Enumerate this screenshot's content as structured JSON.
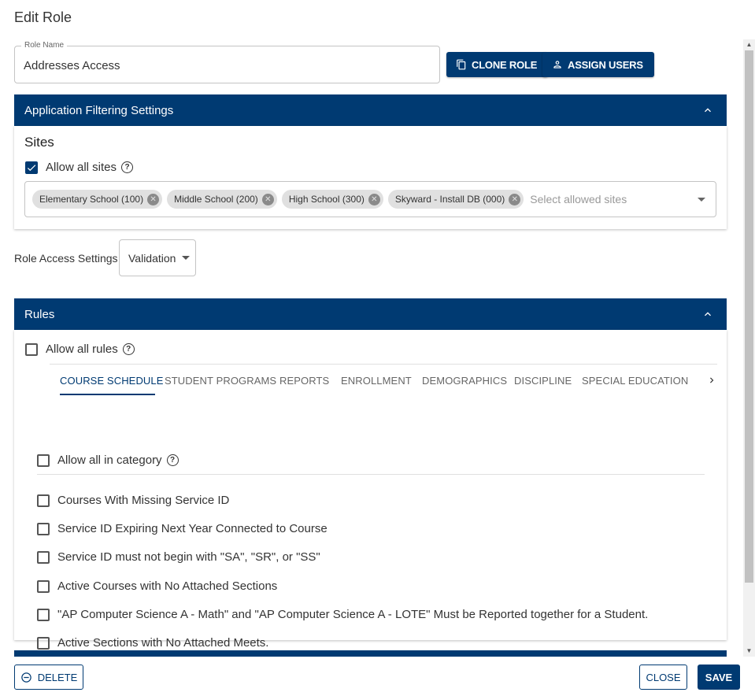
{
  "dialog": {
    "title": "Edit Role"
  },
  "role_name": {
    "legend": "Role Name",
    "value": "Addresses Access"
  },
  "toolbar": {
    "clone_label": "CLONE ROLE",
    "assign_label": "ASSIGN USERS"
  },
  "filtering": {
    "header": "Application Filtering Settings",
    "sites_heading": "Sites",
    "allow_all_sites_label": "Allow all sites",
    "allow_all_sites_checked": true,
    "chips": [
      "Elementary School (100)",
      "Middle School (200)",
      "High School (300)",
      "Skyward - Install DB (000)"
    ],
    "sites_placeholder": "Select allowed sites"
  },
  "role_access": {
    "label": "Role Access Settings",
    "selected": "Validation"
  },
  "rules": {
    "header": "Rules",
    "allow_all_rules_label": "Allow all rules",
    "tabs": [
      "COURSE SCHEDULE",
      "STUDENT PROGRAMS",
      "REPORTS",
      "ENROLLMENT",
      "DEMOGRAPHICS",
      "DISCIPLINE",
      "SPECIAL EDUCATION"
    ],
    "active_tab": "COURSE SCHEDULE",
    "allow_all_category_label": "Allow all in category",
    "items": [
      "Courses With Missing Service ID",
      "Service ID Expiring Next Year Connected to Course",
      "Service ID must not begin with \"SA\", \"SR\", or \"SS\"",
      "Active Courses with No Attached Sections",
      "\"AP Computer Science A - Math\" and \"AP Computer Science A - LOTE\" Must be Reported together for a Student.",
      "Active Sections with No Attached Meets."
    ]
  },
  "footer": {
    "delete_label": "DELETE",
    "close_label": "CLOSE",
    "save_label": "SAVE"
  },
  "colors": {
    "primary": "#003a72",
    "chip_bg": "#e0e0e0",
    "border": "#c4c4c4"
  },
  "icons": {
    "clone": "copy-icon",
    "assign": "person-icon",
    "collapse": "chevron-up-icon",
    "help": "help-circle-icon",
    "chip_remove": "cancel-circle-icon",
    "tab_scroll": "chevron-right-icon",
    "delete": "minus-circle-icon"
  }
}
